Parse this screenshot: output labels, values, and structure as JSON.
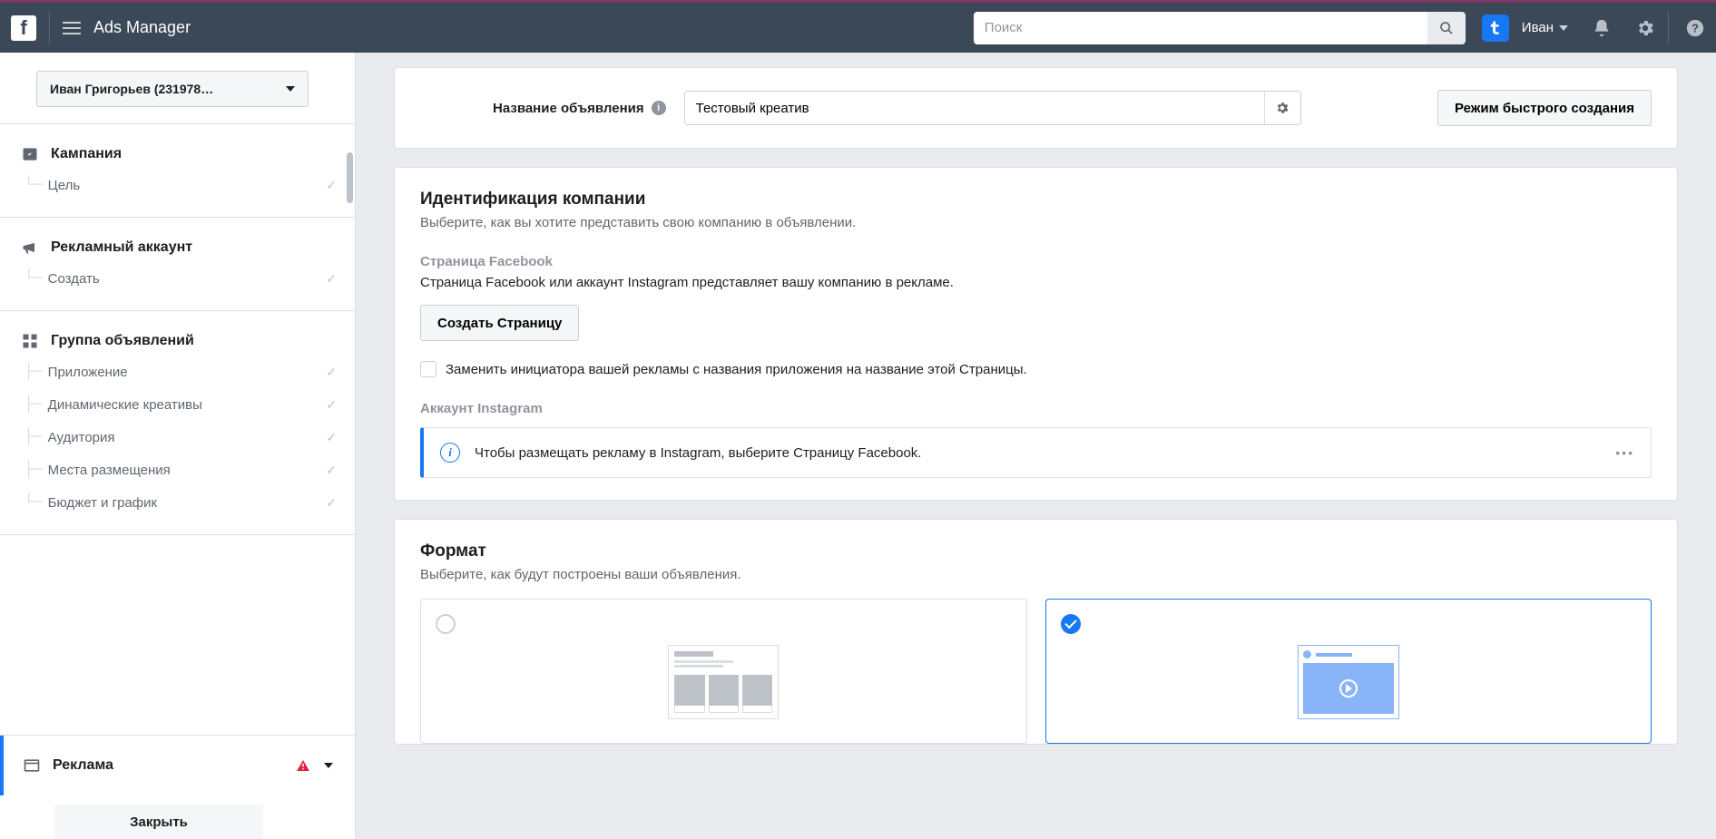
{
  "header": {
    "app_title": "Ads Manager",
    "search_placeholder": "Поиск",
    "user_name": "Иван"
  },
  "sidebar": {
    "account_label": "Иван Григорьев (231978…",
    "campaign": {
      "title": "Кампания",
      "items": [
        "Цель"
      ]
    },
    "ad_account": {
      "title": "Рекламный аккаунт",
      "items": [
        "Создать"
      ]
    },
    "ad_set": {
      "title": "Группа объявлений",
      "items": [
        "Приложение",
        "Динамические креативы",
        "Аудитория",
        "Места размещения",
        "Бюджет и график"
      ]
    },
    "ad": {
      "title": "Реклама"
    },
    "close_label": "Закрыть"
  },
  "main": {
    "ad_name_label": "Название объявления",
    "ad_name_value": "Тестовый креатив",
    "quick_create": "Режим быстрого создания",
    "identity": {
      "title": "Идентификация компании",
      "subtitle": "Выберите, как вы хотите представить свою компанию в объявлении.",
      "fb_page_label": "Страница Facebook",
      "fb_page_desc": "Страница Facebook или аккаунт Instagram представляет вашу компанию в рекламе.",
      "create_page_btn": "Создать Страницу",
      "replace_sponsor": "Заменить инициатора вашей рекламы с названия приложения на название этой Страницы.",
      "ig_label": "Аккаунт Instagram",
      "ig_info": "Чтобы размещать рекламу в Instagram, выберите Страницу Facebook."
    },
    "format": {
      "title": "Формат",
      "subtitle": "Выберите, как будут построены ваши объявления."
    }
  }
}
